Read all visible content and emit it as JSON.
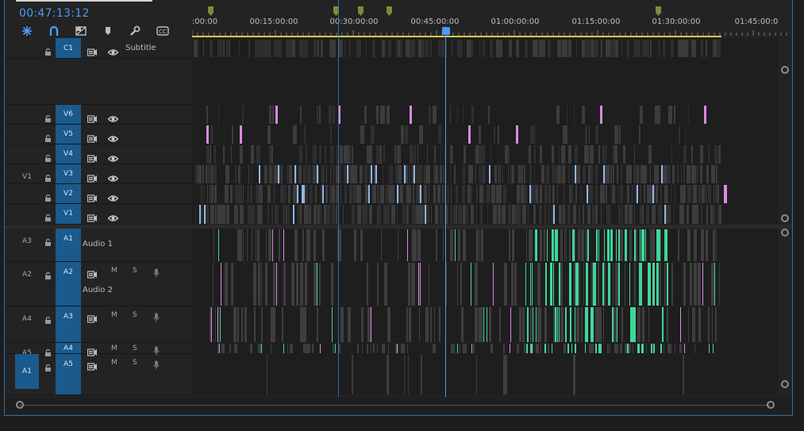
{
  "timecode": "00:47:13:12",
  "colors": {
    "accent": "#4a9df2",
    "target": "#1a5a8c",
    "work_area": "#d4c94a",
    "video_clip": "#8fb7e8",
    "pink_clip": "#d98be0",
    "audio_clip": "#3fd69a",
    "marker": "#7f8a3a"
  },
  "toolbar": {
    "icons": [
      "snap-icon",
      "linked-selection-icon",
      "add-edit-icon",
      "add-marker-icon",
      "settings-wrench-icon",
      "captions-icon"
    ]
  },
  "ruler": {
    "labels": [
      ":00:00",
      "00:15:00:00",
      "00:30:00:00",
      "00:45:00:00",
      "01:00:00:00",
      "01:15:00:00",
      "01:30:00:00",
      "01:45:00:0"
    ]
  },
  "tracks": {
    "caption": {
      "source": "",
      "target": "C1",
      "name": "Subtitle"
    },
    "video": [
      {
        "source": "",
        "target": "V6"
      },
      {
        "source": "",
        "target": "V5"
      },
      {
        "source": "",
        "target": "V4"
      },
      {
        "source": "V1",
        "target": "V3"
      },
      {
        "source": "",
        "target": "V2"
      },
      {
        "source": "",
        "target": "V1"
      }
    ],
    "audio": [
      {
        "source": "A3",
        "target": "A1",
        "name": "Audio 1",
        "m": "M",
        "s": "S"
      },
      {
        "source": "A2",
        "target": "A2",
        "name": "Audio 2",
        "m": "M",
        "s": "S"
      },
      {
        "source": "A4",
        "target": "A3",
        "name": "",
        "m": "M",
        "s": "S"
      },
      {
        "source": "A5",
        "target": "A4",
        "name": "",
        "m": "M",
        "s": "S"
      },
      {
        "source": "A1",
        "target": "A5",
        "name": "",
        "m": "M",
        "s": "S"
      }
    ]
  }
}
